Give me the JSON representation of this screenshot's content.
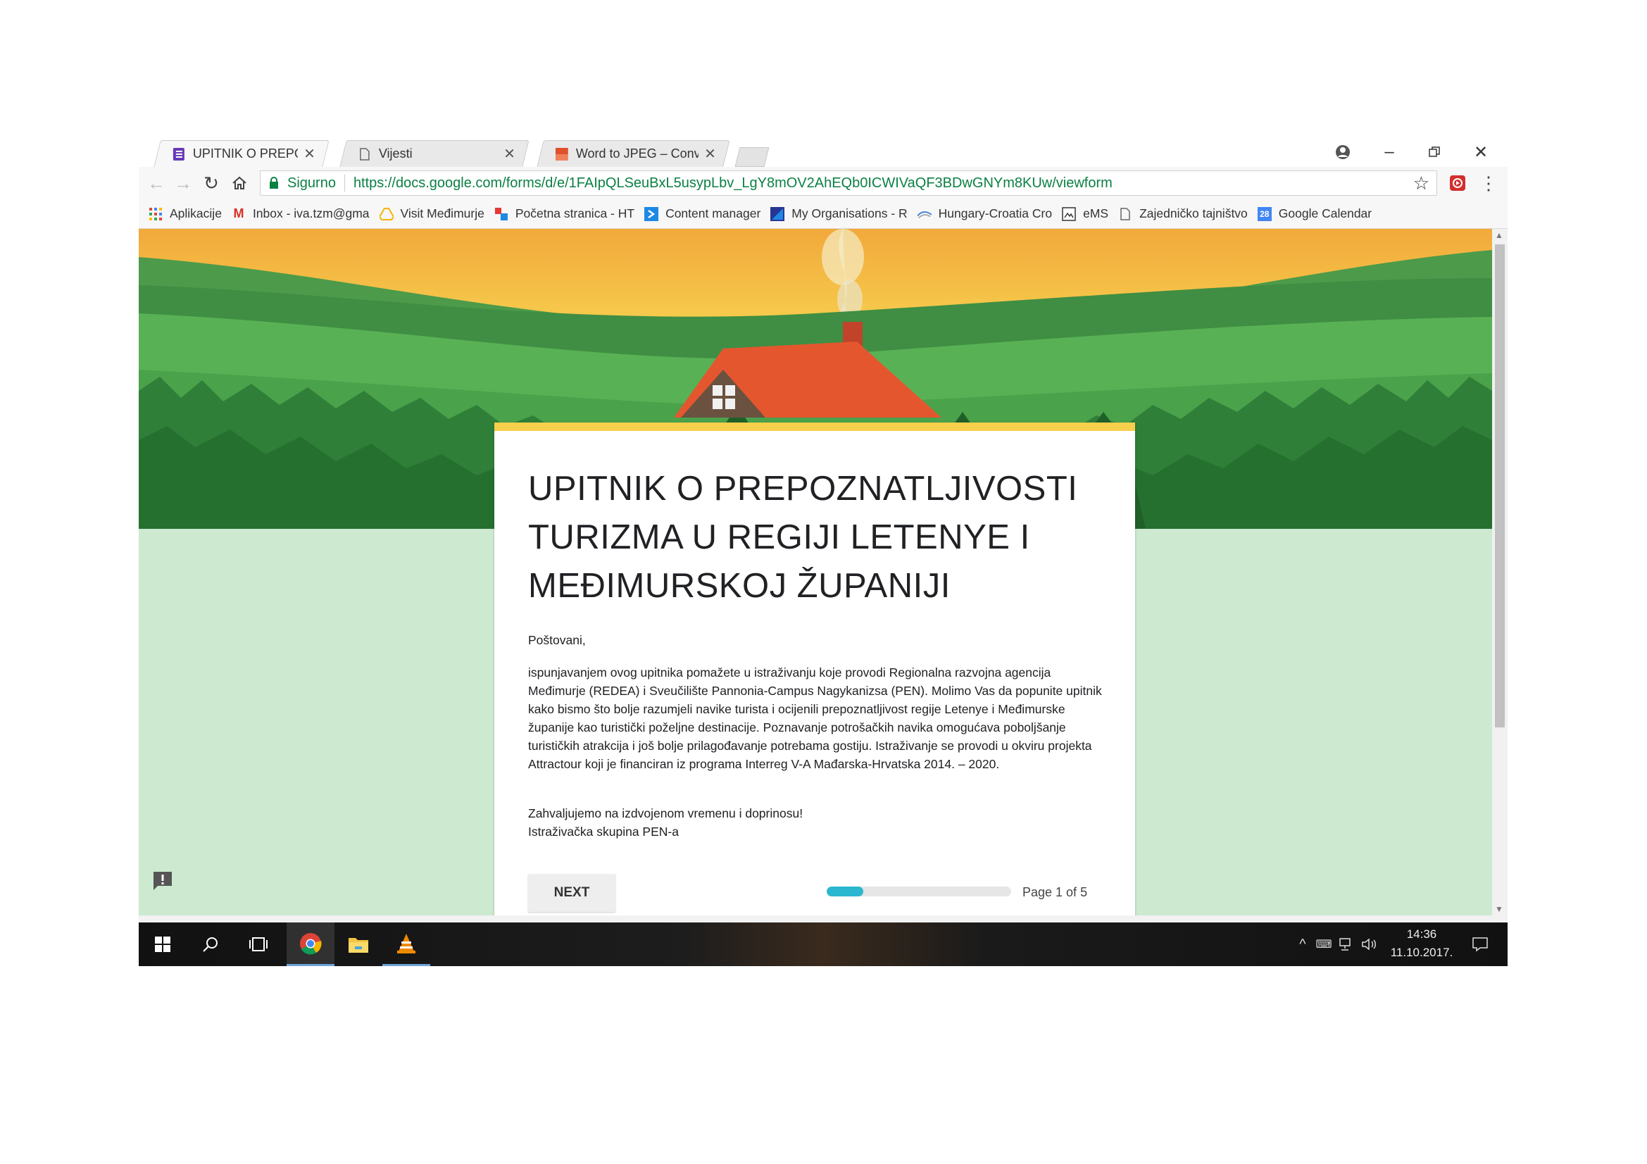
{
  "browser": {
    "tabs": [
      {
        "title": "UPITNIK O PREPOZNATL",
        "active": true,
        "icon": "google-forms-icon"
      },
      {
        "title": "Vijesti",
        "active": false,
        "icon": "page-icon"
      },
      {
        "title": "Word to JPEG – Convert",
        "active": false,
        "icon": "doc-jpeg-icon"
      }
    ],
    "omnibox": {
      "secure_label": "Sigurno",
      "url": "https://docs.google.com/forms/d/e/1FAIpQLSeuBxL5usypLbv_LgY8mOV2AhEQb0ICWIVaQF3BDwGNYm8KUw/viewform"
    },
    "bookmarks": [
      {
        "label": "Aplikacije",
        "icon": "apps-grid-icon"
      },
      {
        "label": "Inbox - iva.tzm@gma",
        "icon": "gmail-icon"
      },
      {
        "label": "Visit Međimurje",
        "icon": "drive-icon"
      },
      {
        "label": "Početna stranica - HT",
        "icon": "site-icon"
      },
      {
        "label": "Content manager",
        "icon": "content-manager-icon"
      },
      {
        "label": "My Organisations - R",
        "icon": "organisation-icon"
      },
      {
        "label": "Hungary-Croatia Cro",
        "icon": "interreg-icon"
      },
      {
        "label": "eMS",
        "icon": "ems-icon"
      },
      {
        "label": "Zajedničko tajništvo",
        "icon": "page-icon"
      },
      {
        "label": "Google Calendar",
        "icon": "calendar-icon",
        "badge": "28"
      }
    ]
  },
  "form": {
    "title": "UPITNIK O PREPOZNATLJIVOSTI TURIZMA U REGIJI LETENYE I MEĐIMURSKOJ ŽUPANIJI",
    "greeting": "Poštovani,",
    "body": "ispunjavanjem ovog upitnika pomažete u istraživanju koje provodi Regionalna razvojna agencija Međimurje (REDEA) i Sveučilište Pannonia-Campus Nagykanizsa (PEN). Molimo Vas da popunite upitnik kako bismo što bolje razumjeli navike turista i ocijenili prepoznatljivost regije Letenye i Međimurske županije kao turistički poželjne destinacije. Poznavanje potrošačkih navika omogućava poboljšanje turističkih atrakcija i još bolje prilagođavanje potrebama gostiju. Istraživanje se provodi u okviru projekta Attractour koji je financiran iz programa Interreg V-A Mađarska-Hrvatska 2014. – 2020.",
    "thanks_line1": "Zahvaljujemo na izdvojenom vremenu i doprinosu!",
    "thanks_line2": "Istraživačka skupina PEN-a",
    "next_label": "NEXT",
    "page_indicator": "Page 1 of 5",
    "progress_fraction": 0.2,
    "accent_color": "#f6cf4d",
    "progress_color": "#2bb7cf",
    "background_color": "#cde9d0"
  },
  "taskbar": {
    "time": "14:36",
    "date": "11.10.2017."
  }
}
